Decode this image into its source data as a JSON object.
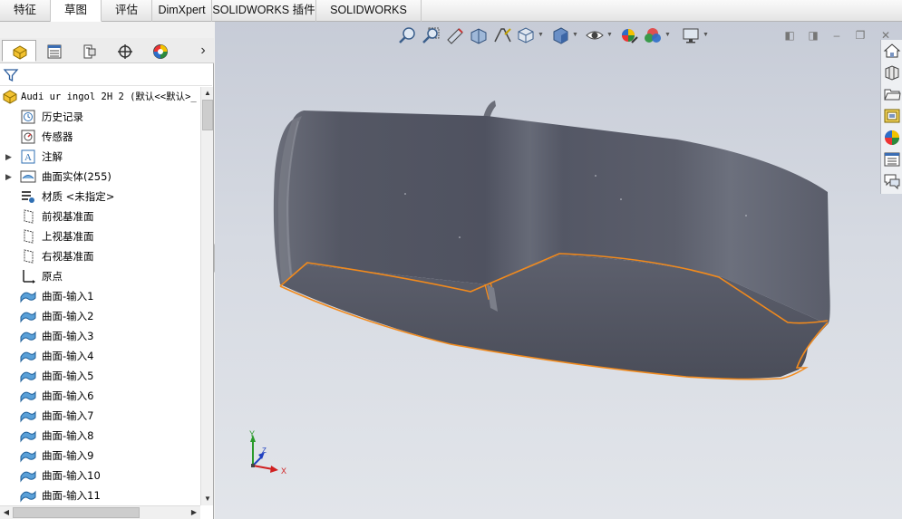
{
  "tabs": [
    "特征",
    "草图",
    "评估",
    "DimXpert",
    "SOLIDWORKS 插件",
    "SOLIDWORKS MBD"
  ],
  "active_tab": "草图",
  "panel_tabs": [
    "feature-manager-icon",
    "property-manager-icon",
    "configuration-manager-icon",
    "dimxpert-manager-icon",
    "display-manager-icon"
  ],
  "tree": {
    "root_label": "Audi ur ingol 2H 2  (默认<<默认>_",
    "items": [
      {
        "label": "历史记录",
        "icon": "history-icon",
        "expandable": false
      },
      {
        "label": "传感器",
        "icon": "sensor-icon",
        "expandable": false
      },
      {
        "label": "注解",
        "icon": "annotation-icon",
        "expandable": true
      },
      {
        "label": "曲面实体(255)",
        "icon": "surface-bodies-icon",
        "expandable": true
      },
      {
        "label": "材质 <未指定>",
        "icon": "material-icon",
        "expandable": false
      },
      {
        "label": "前视基准面",
        "icon": "plane-icon",
        "expandable": false
      },
      {
        "label": "上视基准面",
        "icon": "plane-icon",
        "expandable": false
      },
      {
        "label": "右视基准面",
        "icon": "plane-icon",
        "expandable": false
      },
      {
        "label": "原点",
        "icon": "origin-icon",
        "expandable": false
      },
      {
        "label": "曲面-输入1",
        "icon": "imported-surface-icon",
        "expandable": false
      },
      {
        "label": "曲面-输入2",
        "icon": "imported-surface-icon",
        "expandable": false
      },
      {
        "label": "曲面-输入3",
        "icon": "imported-surface-icon",
        "expandable": false
      },
      {
        "label": "曲面-输入4",
        "icon": "imported-surface-icon",
        "expandable": false
      },
      {
        "label": "曲面-输入5",
        "icon": "imported-surface-icon",
        "expandable": false
      },
      {
        "label": "曲面-输入6",
        "icon": "imported-surface-icon",
        "expandable": false
      },
      {
        "label": "曲面-输入7",
        "icon": "imported-surface-icon",
        "expandable": false
      },
      {
        "label": "曲面-输入8",
        "icon": "imported-surface-icon",
        "expandable": false
      },
      {
        "label": "曲面-输入9",
        "icon": "imported-surface-icon",
        "expandable": false
      },
      {
        "label": "曲面-输入10",
        "icon": "imported-surface-icon",
        "expandable": false
      },
      {
        "label": "曲面-输入11",
        "icon": "imported-surface-icon",
        "expandable": false
      }
    ]
  },
  "hud_icons": [
    "zoom-to-fit-icon",
    "zoom-to-area-icon",
    "previous-view-icon",
    "section-view-icon",
    "dynamic-annotation-icon",
    "view-orientation-icon",
    "display-style-icon",
    "hide-show-items-icon",
    "edit-appearance-icon",
    "apply-scene-icon",
    "view-settings-icon"
  ],
  "task_pane_icons": [
    "home-icon",
    "parts-library-icon",
    "file-explorer-icon",
    "view-palette-icon",
    "appearances-icon",
    "custom-properties-icon",
    "forum-icon"
  ],
  "triad": {
    "x": "X",
    "y": "Y",
    "z": "Z"
  },
  "colors": {
    "body": "#5c5f6b",
    "edge_highlight": "#f28a1c",
    "accent": "#2f6fb3"
  }
}
